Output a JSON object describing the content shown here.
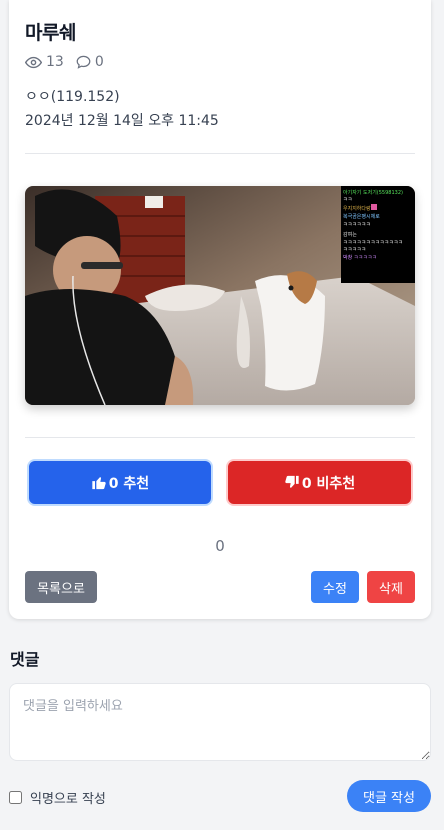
{
  "post": {
    "title": "마루쉐",
    "views": "13",
    "comments_count": "0",
    "author": "ㅇㅇ(119.152)",
    "date": "2024년 12월 14일 오후 11:45"
  },
  "media": {
    "chat_lines": [
      "아기자기 도저기(5598132)",
      "ㅋㅋ",
      "우지지하다랑",
      "복극곰은팽시체로",
      "ㅋㅋㅋㅋㅋㅋ",
      "감여는",
      "ㅋㅋㅋㅋㅋㅋㅋㅋㅋㅋㅋㅋㅋ",
      "ㅋㅋㅋㅋㅋ",
      "박창 ㅋㅋㅋㅋㅋ"
    ]
  },
  "votes": {
    "up_label": "0 추천",
    "down_label": "0 비추천",
    "score": "0"
  },
  "actions": {
    "list_label": "목록으로",
    "edit_label": "수정",
    "delete_label": "삭제"
  },
  "comments": {
    "heading": "댓글",
    "placeholder": "댓글을 입력하세요",
    "anonymous_label": "익명으로 작성",
    "submit_label": "댓글 작성"
  },
  "colors": {
    "upvote": "#2563eb",
    "downvote": "#dc2626",
    "primary": "#3b82f6",
    "danger": "#ef4444",
    "neutral": "#6b7280"
  }
}
